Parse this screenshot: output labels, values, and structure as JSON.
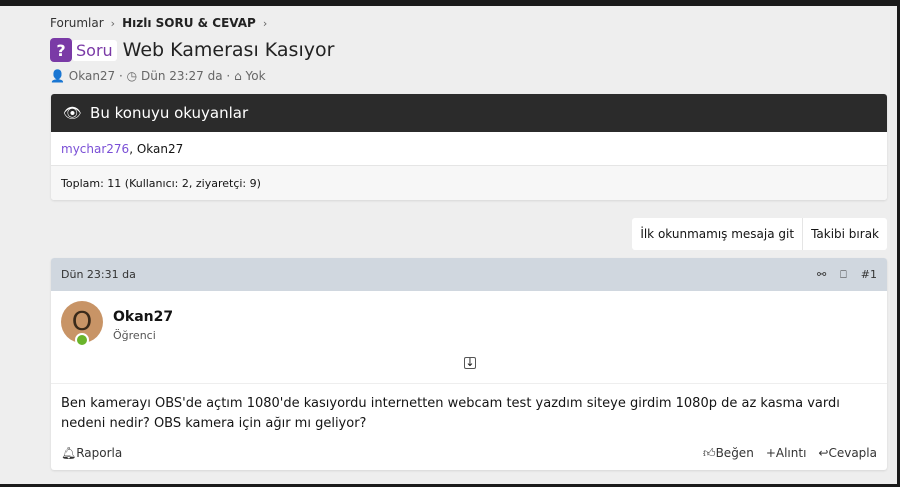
{
  "breadcrumb": {
    "items": [
      "Forumlar",
      "Hızlı SORU & CEVAP"
    ]
  },
  "thread": {
    "prefix": "Soru",
    "title": "Web Kamerası Kasıyor",
    "author": "Okan27",
    "date": "Dün 23:27 da",
    "tags": "Yok"
  },
  "readers": {
    "title": "Bu konuyu okuyanlar",
    "users": [
      "mychar276",
      "Okan27"
    ],
    "total": "Toplam: 11 (Kullanıcı: 2, ziyaretçi: 9)"
  },
  "actions": {
    "unread": "İlk okunmamış mesaja git",
    "unwatch": "Takibi bırak"
  },
  "post": {
    "date": "Dün 23:31 da",
    "number": "#1",
    "avatar_letter": "O",
    "username": "Okan27",
    "role": "Öğrenci",
    "body": "Ben kamerayı OBS'de açtım 1080'de kasıyordu internetten webcam test yazdım siteye girdim 1080p de az kasma vardı nedeni nedir? OBS kamera için ağır mı geliyor?",
    "report": "Raporla",
    "like": "Beğen",
    "quote": "Alıntı",
    "reply": "Cevapla"
  }
}
